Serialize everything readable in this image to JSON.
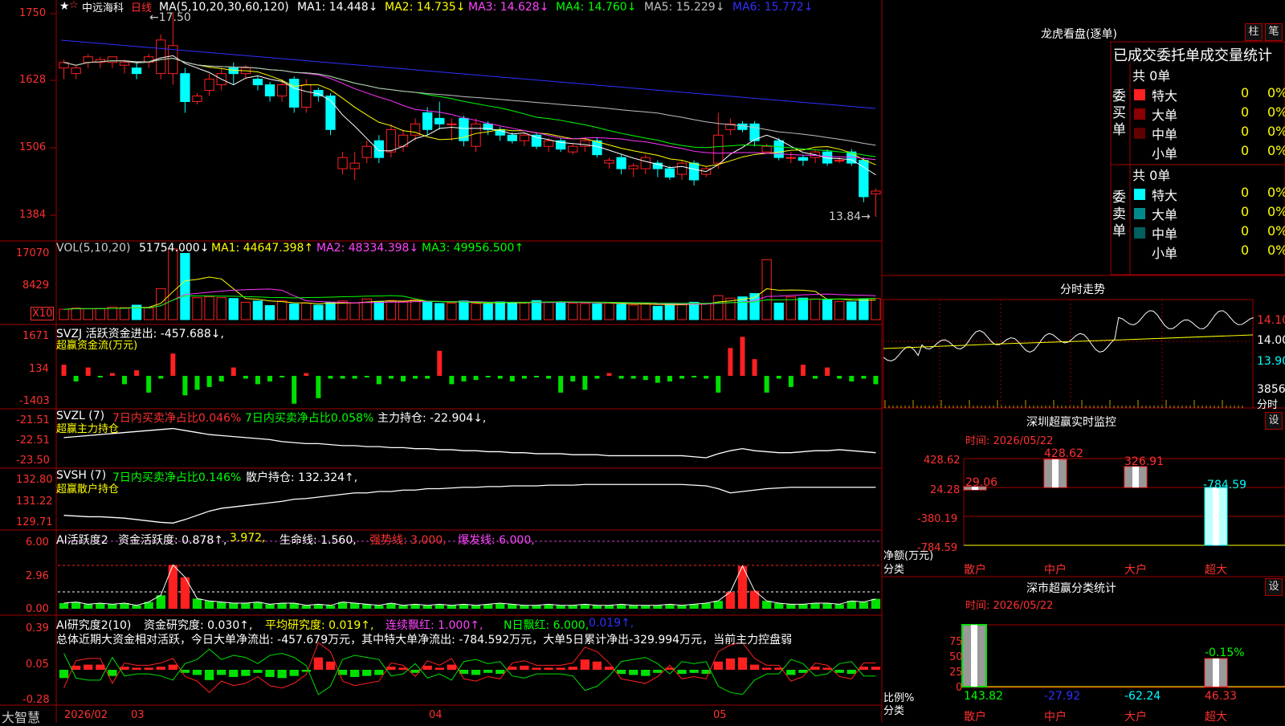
{
  "stock": {
    "name": "中远海科",
    "period": "日线",
    "star": "★",
    "pinned": "☆"
  },
  "colors": {
    "up": "#ff2020",
    "down": "#00ffff",
    "grid": "#a00000",
    "ma1": "#ffffff",
    "ma2": "#ffff00",
    "ma3": "#ff33ff",
    "ma4": "#00ff00",
    "ma5": "#c0c0c0",
    "ma6": "#3030ff",
    "green": "#00e000",
    "purple": "#cc44cc",
    "yellow": "#ffff00"
  },
  "main": {
    "ma_header": {
      "prefix": "MA(5,10,20,30,60,120)",
      "ma1": "MA1: 14.448↓",
      "ma2": "MA2: 14.735↓",
      "ma3": "MA3: 14.628↓",
      "ma4": "MA4: 14.760↓",
      "ma5": "MA5: 15.229↓",
      "ma6": "MA6: 15.772↓"
    },
    "y_ticks": [
      "1750",
      "1628",
      "1506",
      "1384"
    ],
    "high_label": "←17.50",
    "low_label": "13.84→"
  },
  "vol": {
    "header": "VOL(5,10,20)",
    "value": "51754.000↓",
    "ma1": "MA1: 44647.398↑",
    "ma2": "MA2: 48334.398↓",
    "ma3": "MA3: 49956.500↑",
    "y_ticks": [
      "17070",
      "8429"
    ],
    "unit": "X10"
  },
  "svzj": {
    "header": "SVZJ  活跃资金进出: -457.688↓,",
    "sub": "超赢资金流(万元)",
    "y_ticks": [
      "1671",
      "134",
      "-1403"
    ]
  },
  "svzl": {
    "header": "SVZL (7)",
    "a": "7日内买卖净占比0.046%",
    "b": "7日内买卖净占比0.058%",
    "c": "主力持仓: -22.904↓,",
    "sub": "超赢主力持仓",
    "y_ticks": [
      "-21.51",
      "-22.51",
      "-23.50"
    ]
  },
  "svsh": {
    "header": "SVSH (7)",
    "a": "7日内买卖净占比0.146%",
    "c": "散户持仓: 132.324↑,",
    "sub": "超赢散户持仓",
    "y_ticks": [
      "132.80",
      "131.22",
      "129.71"
    ]
  },
  "ai1": {
    "header": "AI活跃度2",
    "a": "资金活跃度: 0.878↑,",
    "b": "3.972,",
    "c": "生命线: 1.560,",
    "d": "强势线: 3.000,",
    "e": "爆发线: 6.000,",
    "y_ticks": [
      "6.00",
      "2.96",
      "0.00"
    ]
  },
  "ai2": {
    "header": "AI研究度2(10)",
    "a": "资金研究度: 0.030↑,",
    "b": "平均研究度: 0.019↑,",
    "c": "连续飘红: 1.000↑,",
    "d": "N日飘红: 6.000,",
    "e": "0.019↑,",
    "summary": "总体近期大资金相对活跃，今日大单净流出: -457.679万元，其中特大单净流出: -784.592万元，大单5日累计净出-329.994万元，当前主力控盘弱",
    "y_ticks": [
      "0.39",
      "0.05",
      "-0.28"
    ]
  },
  "xaxis": {
    "brand": "大智慧",
    "labels": [
      "2026/02",
      "03",
      "04",
      "05"
    ]
  },
  "dragon": {
    "title": "龙虎看盘(逐单)",
    "btn1": "柱",
    "btn2": "笔",
    "table_title": "已成交委托单成交量统计",
    "buy": {
      "label": "委买单",
      "total": "共 0单",
      "rows": [
        {
          "name": "特大",
          "v": "0",
          "p": "0%"
        },
        {
          "name": "大单",
          "v": "0",
          "p": "0%"
        },
        {
          "name": "中单",
          "v": "0",
          "p": "0%"
        },
        {
          "name": "小单",
          "v": "0",
          "p": "0%"
        }
      ]
    },
    "sell": {
      "label": "委卖单",
      "total": "共 0单",
      "rows": [
        {
          "name": "特大",
          "v": "0",
          "p": "0%"
        },
        {
          "name": "大单",
          "v": "0",
          "p": "0%"
        },
        {
          "name": "中单",
          "v": "0",
          "p": "0%"
        },
        {
          "name": "小单",
          "v": "0",
          "p": "0%"
        }
      ]
    }
  },
  "intraday": {
    "title": "分时走势",
    "y_ticks": [
      "14.10",
      "14.00",
      "13.90"
    ],
    "vol_label": "3856",
    "sub": "分时"
  },
  "monitor": {
    "title": "深圳超赢实时监控",
    "btn": "设",
    "time": "时间: 2026/05/22",
    "y_ticks": [
      "428.62",
      "24.28",
      "-380.19",
      "-784.59"
    ],
    "ylabel": "净额(万元)",
    "xlabel": "分类",
    "cats": [
      "散户",
      "中户",
      "大户",
      "超大"
    ],
    "values": [
      "29.06",
      "428.62",
      "326.91",
      "-784.59"
    ]
  },
  "classify": {
    "title": "深市超赢分类统计",
    "btn": "设",
    "time": "时间: 2026/05/22",
    "y_ticks": [
      "75",
      "50",
      "25",
      "0"
    ],
    "ylabel": "比例%",
    "xlabel": "分类",
    "cats": [
      "散户",
      "中户",
      "大户",
      "超大"
    ],
    "values": [
      "143.82",
      "-27.92",
      "-62.24",
      "46.33"
    ],
    "top_label": "-0.15%"
  },
  "chart_data": [
    {
      "type": "candlestick",
      "title": "中远海科 日线",
      "ylim": [
        13.84,
        17.5
      ],
      "ticks": [
        17.5,
        16.28,
        15.06,
        13.84
      ],
      "ohlc": [
        [
          16.5,
          16.6,
          16.3,
          16.65
        ],
        [
          16.4,
          16.5,
          16.3,
          16.55
        ],
        [
          16.6,
          16.7,
          16.5,
          16.75
        ],
        [
          16.6,
          16.65,
          16.5,
          16.7
        ],
        [
          16.6,
          16.7,
          16.5,
          16.7
        ],
        [
          16.55,
          16.6,
          16.4,
          16.65
        ],
        [
          16.5,
          16.4,
          16.3,
          16.6
        ],
        [
          16.6,
          16.7,
          16.5,
          16.75
        ],
        [
          16.4,
          17.0,
          16.3,
          17.1
        ],
        [
          16.4,
          16.9,
          16.2,
          17.5
        ],
        [
          16.4,
          15.9,
          15.7,
          16.5
        ],
        [
          15.9,
          16.0,
          15.85,
          16.05
        ],
        [
          16.1,
          16.3,
          16.0,
          16.4
        ],
        [
          16.2,
          16.4,
          16.1,
          16.5
        ],
        [
          16.5,
          16.4,
          16.2,
          16.6
        ],
        [
          16.4,
          16.5,
          16.3,
          16.55
        ],
        [
          16.3,
          16.2,
          16.1,
          16.35
        ],
        [
          16.2,
          16.0,
          15.9,
          16.25
        ],
        [
          16.0,
          16.2,
          15.9,
          16.3
        ],
        [
          16.3,
          15.8,
          15.7,
          16.35
        ],
        [
          15.8,
          16.2,
          15.7,
          16.3
        ],
        [
          16.1,
          16.0,
          15.9,
          16.15
        ],
        [
          16.0,
          15.4,
          15.3,
          16.05
        ],
        [
          14.7,
          14.9,
          14.6,
          15.0
        ],
        [
          14.7,
          14.8,
          14.5,
          15.0
        ],
        [
          14.9,
          15.1,
          14.8,
          15.2
        ],
        [
          15.2,
          14.9,
          14.8,
          15.3
        ],
        [
          15.0,
          15.4,
          14.9,
          15.5
        ],
        [
          15.1,
          15.3,
          15.0,
          15.4
        ],
        [
          15.3,
          15.5,
          15.2,
          15.6
        ],
        [
          15.7,
          15.4,
          15.3,
          15.8
        ],
        [
          15.6,
          15.5,
          15.4,
          15.9
        ],
        [
          15.5,
          15.5,
          15.2,
          15.6
        ],
        [
          15.6,
          15.2,
          15.1,
          15.65
        ],
        [
          15.1,
          15.5,
          15.0,
          15.6
        ],
        [
          15.5,
          15.4,
          15.3,
          15.55
        ],
        [
          15.4,
          15.3,
          15.2,
          15.45
        ],
        [
          15.3,
          15.2,
          15.15,
          15.35
        ],
        [
          15.2,
          15.3,
          15.1,
          15.35
        ],
        [
          15.3,
          15.1,
          15.05,
          15.35
        ],
        [
          15.1,
          15.2,
          15.0,
          15.25
        ],
        [
          15.2,
          15.05,
          15.0,
          15.25
        ],
        [
          15.0,
          15.1,
          14.95,
          15.15
        ],
        [
          15.1,
          15.2,
          15.0,
          15.25
        ],
        [
          15.2,
          14.95,
          14.9,
          15.25
        ],
        [
          14.8,
          14.85,
          14.7,
          14.9
        ],
        [
          14.9,
          14.7,
          14.6,
          14.95
        ],
        [
          14.7,
          14.75,
          14.55,
          14.8
        ],
        [
          14.7,
          14.9,
          14.6,
          14.95
        ],
        [
          14.8,
          14.7,
          14.55,
          14.85
        ],
        [
          14.7,
          14.55,
          14.5,
          14.75
        ],
        [
          14.6,
          14.8,
          14.5,
          14.85
        ],
        [
          14.8,
          14.5,
          14.4,
          14.85
        ],
        [
          14.6,
          14.7,
          14.55,
          14.75
        ],
        [
          14.8,
          15.3,
          14.7,
          15.7
        ],
        [
          15.4,
          15.5,
          15.3,
          15.6
        ],
        [
          15.5,
          15.4,
          15.35,
          15.55
        ],
        [
          15.5,
          15.2,
          15.1,
          15.55
        ],
        [
          15.0,
          15.1,
          15.0,
          15.15
        ],
        [
          15.2,
          14.9,
          14.85,
          15.25
        ],
        [
          14.9,
          14.9,
          14.8,
          15.0
        ],
        [
          14.9,
          14.85,
          14.75,
          14.95
        ],
        [
          14.9,
          15.0,
          14.8,
          15.05
        ],
        [
          15.0,
          14.8,
          14.75,
          15.05
        ],
        [
          14.85,
          14.85,
          14.8,
          14.9
        ],
        [
          15.0,
          14.8,
          14.75,
          15.05
        ],
        [
          14.85,
          14.2,
          14.1,
          14.9
        ],
        [
          14.25,
          14.3,
          13.84,
          14.35
        ]
      ]
    },
    {
      "type": "bar",
      "title": "VOL(5,10,20)",
      "ylim": [
        0,
        17070
      ],
      "values": [
        2500,
        2800,
        2600,
        2700,
        3000,
        2900,
        3500,
        2800,
        7500,
        17070,
        16000,
        5300,
        5500,
        5300,
        5100,
        4200,
        4500,
        3400,
        4500,
        3800,
        4000,
        3500,
        4200,
        4500,
        4000,
        5000,
        4400,
        4600,
        4300,
        4800,
        4200,
        3900,
        4000,
        4500,
        3900,
        3800,
        4300,
        4000,
        4100,
        4600,
        4200,
        4300,
        4000,
        3900,
        3800,
        4100,
        3700,
        3500,
        3800,
        3200,
        3900,
        3600,
        4200,
        3800,
        5800,
        5200,
        5500,
        6300,
        14500,
        4000,
        5500,
        5200,
        5000,
        4800,
        4400,
        4300,
        5000,
        5100
      ]
    },
    {
      "type": "bar",
      "title": "超赢资金流(万元)",
      "ylim": [
        -1403,
        1671
      ],
      "values": [
        400,
        -200,
        300,
        -50,
        100,
        -300,
        200,
        -600,
        -100,
        800,
        -700,
        -500,
        -400,
        -200,
        300,
        -100,
        -300,
        -200,
        -50,
        -1000,
        100,
        -800,
        -100,
        -100,
        -100,
        -50,
        -300,
        -100,
        -200,
        -100,
        -100,
        900,
        -300,
        -200,
        -150,
        -50,
        -100,
        -200,
        -100,
        -50,
        -100,
        -600,
        -200,
        -500,
        -100,
        100,
        -100,
        -100,
        -150,
        -250,
        -200,
        -100,
        -50,
        -100,
        -600,
        1000,
        1400,
        600,
        -600,
        -100,
        -400,
        400,
        -100,
        300,
        -100,
        -200,
        -100,
        -300
      ]
    },
    {
      "type": "line",
      "title": "超赢主力持仓",
      "ylim": [
        -23.5,
        -21.51
      ],
      "values": [
        -22.3,
        -22.25,
        -22.2,
        -22.15,
        -22.1,
        -22.05,
        -22.0,
        -21.95,
        -21.9,
        -21.85,
        -21.95,
        -22.05,
        -22.15,
        -22.2,
        -22.25,
        -22.3,
        -22.35,
        -22.4,
        -22.5,
        -22.55,
        -22.6,
        -22.6,
        -22.65,
        -22.7,
        -22.7,
        -22.75,
        -22.75,
        -22.8,
        -22.8,
        -22.85,
        -22.85,
        -22.9,
        -22.9,
        -22.95,
        -22.95,
        -23.0,
        -23.0,
        -23.05,
        -23.05,
        -23.1,
        -23.1,
        -23.1,
        -23.15,
        -23.15,
        -23.15,
        -23.2,
        -23.2,
        -23.2,
        -23.2,
        -23.2,
        -23.2,
        -23.2,
        -23.25,
        -23.3,
        -23.1,
        -22.95,
        -22.85,
        -22.95,
        -23.0,
        -23.05,
        -23.05,
        -23.0,
        -22.95,
        -22.95,
        -22.9,
        -22.95,
        -23.0,
        -23.05
      ]
    },
    {
      "type": "line",
      "title": "超赢散户持仓",
      "ylim": [
        129.71,
        132.8
      ],
      "values": [
        130.3,
        130.25,
        130.2,
        130.2,
        130.15,
        130.1,
        130.0,
        129.9,
        129.8,
        129.75,
        130.0,
        130.3,
        130.6,
        130.8,
        130.9,
        131.0,
        131.1,
        131.2,
        131.3,
        131.45,
        131.5,
        131.6,
        131.7,
        131.8,
        131.9,
        131.9,
        132.0,
        132.0,
        132.1,
        132.1,
        132.2,
        132.2,
        132.25,
        132.3,
        132.3,
        132.35,
        132.35,
        132.4,
        132.4,
        132.4,
        132.45,
        132.45,
        132.45,
        132.5,
        132.5,
        132.5,
        132.5,
        132.5,
        132.5,
        132.5,
        132.5,
        132.5,
        132.45,
        132.4,
        132.2,
        131.9,
        132.0,
        132.1,
        132.2,
        132.25,
        132.3,
        132.3,
        132.3,
        132.3,
        132.3,
        132.3,
        132.3,
        132.3
      ]
    },
    {
      "type": "bar",
      "title": "AI活跃度2",
      "ylim": [
        0,
        6.0
      ],
      "values": [
        0.5,
        0.6,
        0.4,
        0.5,
        0.4,
        0.5,
        0.3,
        0.6,
        1.2,
        3.9,
        2.8,
        0.9,
        0.7,
        0.6,
        0.5,
        0.5,
        0.6,
        0.4,
        0.5,
        0.5,
        0.3,
        0.4,
        0.3,
        0.6,
        0.5,
        0.4,
        0.3,
        0.5,
        0.3,
        0.4,
        0.3,
        0.4,
        0.3,
        0.4,
        0.3,
        0.4,
        0.5,
        0.4,
        0.3,
        0.3,
        0.4,
        0.3,
        0.3,
        0.4,
        0.3,
        0.3,
        0.4,
        0.3,
        0.3,
        0.3,
        0.4,
        0.3,
        0.4,
        0.5,
        0.7,
        1.5,
        3.8,
        1.6,
        0.7,
        0.5,
        0.4,
        0.4,
        0.5,
        0.5,
        0.4,
        0.7,
        0.6,
        0.878
      ]
    },
    {
      "type": "bar",
      "title": "AI研究度2(10)",
      "ylim": [
        -0.28,
        0.39
      ],
      "values": [
        -0.08,
        0.04,
        0.05,
        0.05,
        -0.06,
        0.03,
        0.02,
        0.02,
        0.03,
        0.05,
        -0.03,
        -0.05,
        -0.1,
        -0.05,
        -0.07,
        -0.06,
        -0.03,
        -0.07,
        -0.08,
        -0.06,
        -0.02,
        0.12,
        0.08,
        -0.05,
        -0.07,
        -0.06,
        -0.05,
        0.03,
        0.02,
        -0.03,
        0.04,
        0.02,
        0.05,
        -0.04,
        -0.05,
        -0.03,
        -0.04,
        0.03,
        0.04,
        0.02,
        0.02,
        0.02,
        0.03,
        0.1,
        0.08,
        0.03,
        -0.04,
        -0.05,
        -0.06,
        -0.03,
        0.02,
        -0.04,
        -0.03,
        -0.04,
        0.08,
        0.11,
        0.12,
        0.05,
        0.02,
        0.02,
        -0.05,
        -0.03,
        0.03,
        0.02,
        -0.03,
        -0.04,
        0.03,
        0.03
      ]
    }
  ]
}
